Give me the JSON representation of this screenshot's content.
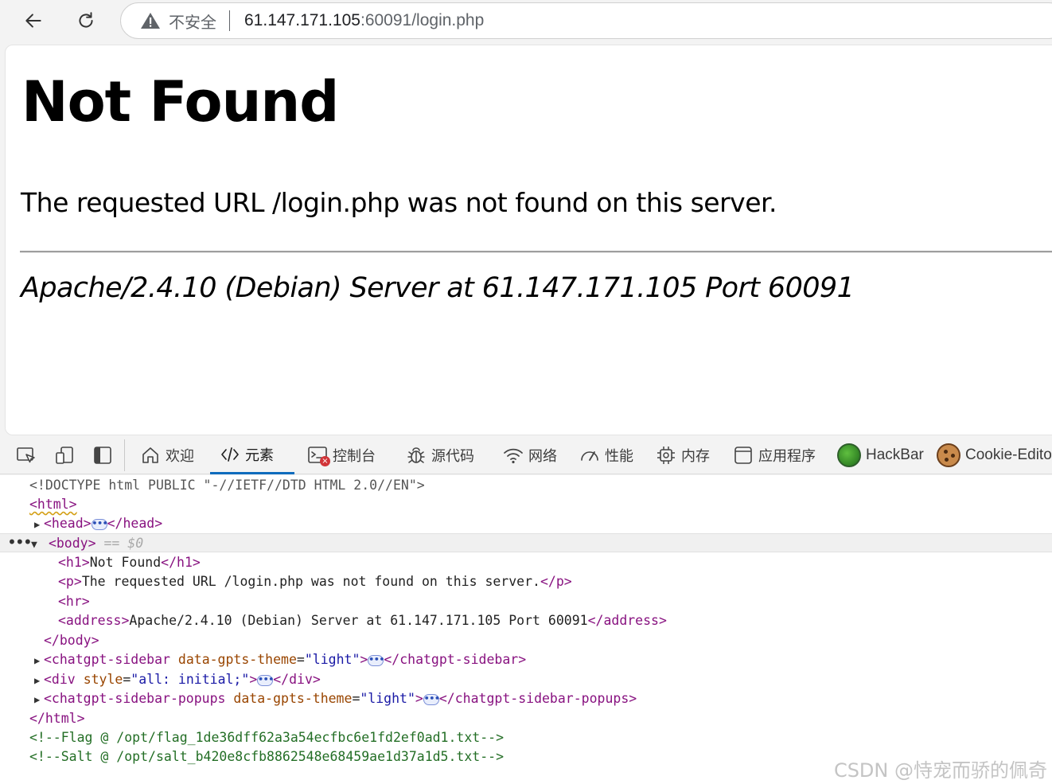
{
  "browser": {
    "security_label": "不安全",
    "url_host": "61.147.171.105",
    "url_rest": ":60091/login.php"
  },
  "page": {
    "heading": "Not Found",
    "message": "The requested URL /login.php was not found on this server.",
    "address": "Apache/2.4.10 (Debian) Server at 61.147.171.105 Port 60091"
  },
  "devtools": {
    "tabs": {
      "welcome": "欢迎",
      "elements": "元素",
      "console": "控制台",
      "sources": "源代码",
      "network": "网络",
      "performance": "性能",
      "memory": "内存",
      "application": "应用程序",
      "hackbar": "HackBar",
      "cookie_editor": "Cookie-Editor"
    },
    "elements": {
      "doctype": "<!DOCTYPE html PUBLIC \"-//IETF//DTD HTML 2.0//EN\">",
      "html_open": "<html>",
      "head_open": "<head>",
      "head_close": "</head>",
      "body_open": "<body>",
      "body_marker": "== $0",
      "h1_open": "<h1>",
      "h1_text": "Not Found",
      "h1_close": "</h1>",
      "p_open": "<p>",
      "p_text": "The requested URL /login.php was not found on this server.",
      "p_close": "</p>",
      "hr": "<hr>",
      "address_open": "<address>",
      "address_text": "Apache/2.4.10 (Debian) Server at 61.147.171.105 Port 60091",
      "address_close": "</address>",
      "body_close": "</body>",
      "sidebar_tag": "<chatgpt-sidebar",
      "sidebar_attr": "data-gpts-theme",
      "sidebar_val": "\"light\"",
      "sidebar_close": "</chatgpt-sidebar>",
      "div_tag": "<div",
      "div_attr": "style",
      "div_val": "\"all: initial;\"",
      "div_close": "</div>",
      "popups_tag": "<chatgpt-sidebar-popups",
      "popups_attr": "data-gpts-theme",
      "popups_val": "\"light\"",
      "popups_close": "</chatgpt-sidebar-popups>",
      "html_close": "</html>",
      "comment_flag": "<!--Flag @ /opt/flag_1de36dff62a3a54ecfbc6e1fd2ef0ad1.txt-->",
      "comment_salt": "<!--Salt @ /opt/salt_b420e8cfb8862548e68459ae1d37a1d5.txt-->"
    }
  },
  "watermark": "CSDN @恃宠而骄的佩奇"
}
